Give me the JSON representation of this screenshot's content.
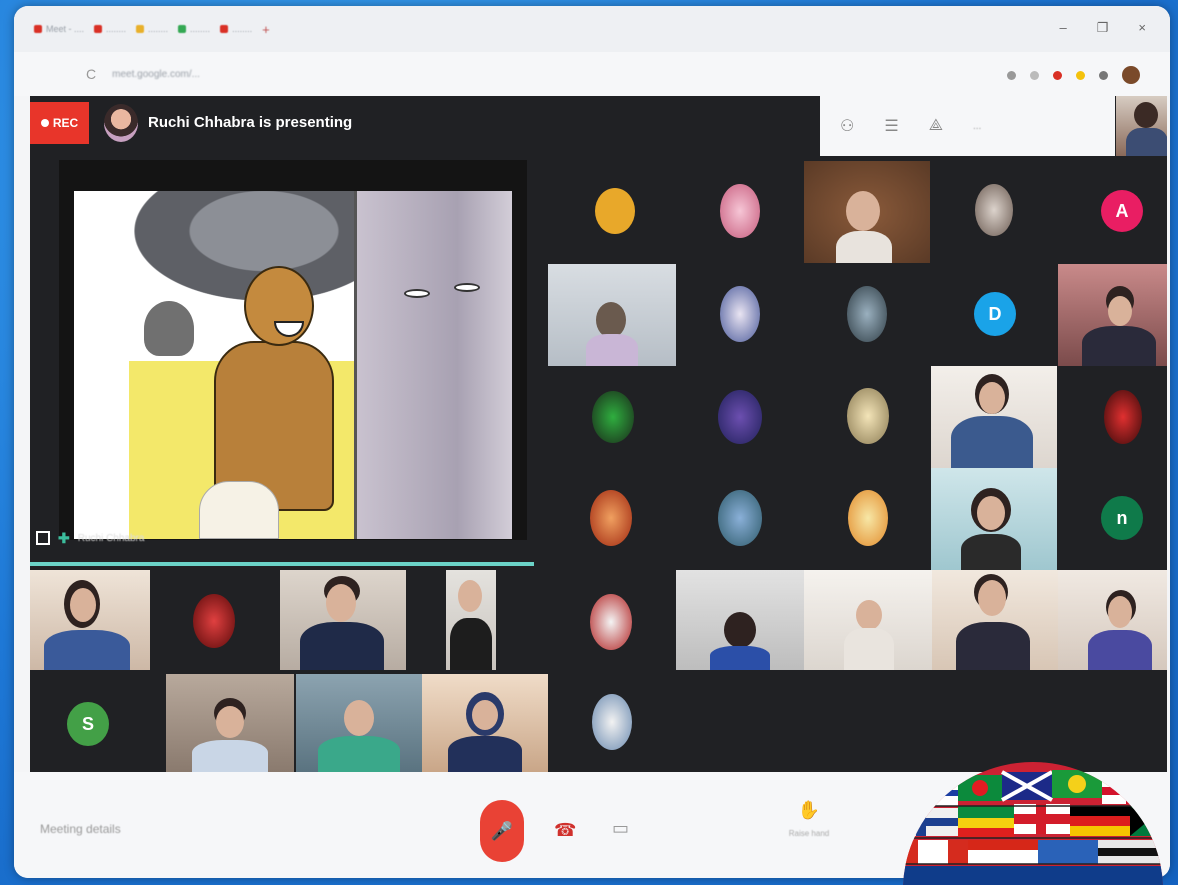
{
  "browser": {
    "tabs": [
      {
        "label": "Meet - ....",
        "fav": "#d93025"
      },
      {
        "label": "........",
        "fav": "#d93025"
      },
      {
        "label": "........",
        "fav": "#e8b02a"
      },
      {
        "label": "........",
        "fav": "#34a853"
      },
      {
        "label": "........",
        "fav": "#d93025"
      }
    ],
    "new_tab": "+",
    "window_controls": [
      "–",
      "❐",
      "×"
    ],
    "url": "meet.google.com/...",
    "reload": "C"
  },
  "meet": {
    "rec_label": "REC",
    "presenting_text": "Ruchi Chhabra is presenting",
    "share_label": "Ruchi Chhabra",
    "top_controls_time": "...",
    "meeting_details": "Meeting details",
    "raise_hand_label": "Raise hand",
    "letter_avatars": [
      {
        "letter": "A",
        "color": "#e91e63"
      },
      {
        "letter": "D",
        "color": "#1aa3e8"
      },
      {
        "letter": "n",
        "color": "#0f7a4a"
      },
      {
        "letter": "S",
        "color": "#43a047"
      }
    ]
  },
  "icons": {
    "mic": "🎤",
    "hangup": "☎",
    "camera": "▭",
    "hand": "✋",
    "people": "⚇",
    "chat": "☰",
    "activities": "⟁"
  }
}
